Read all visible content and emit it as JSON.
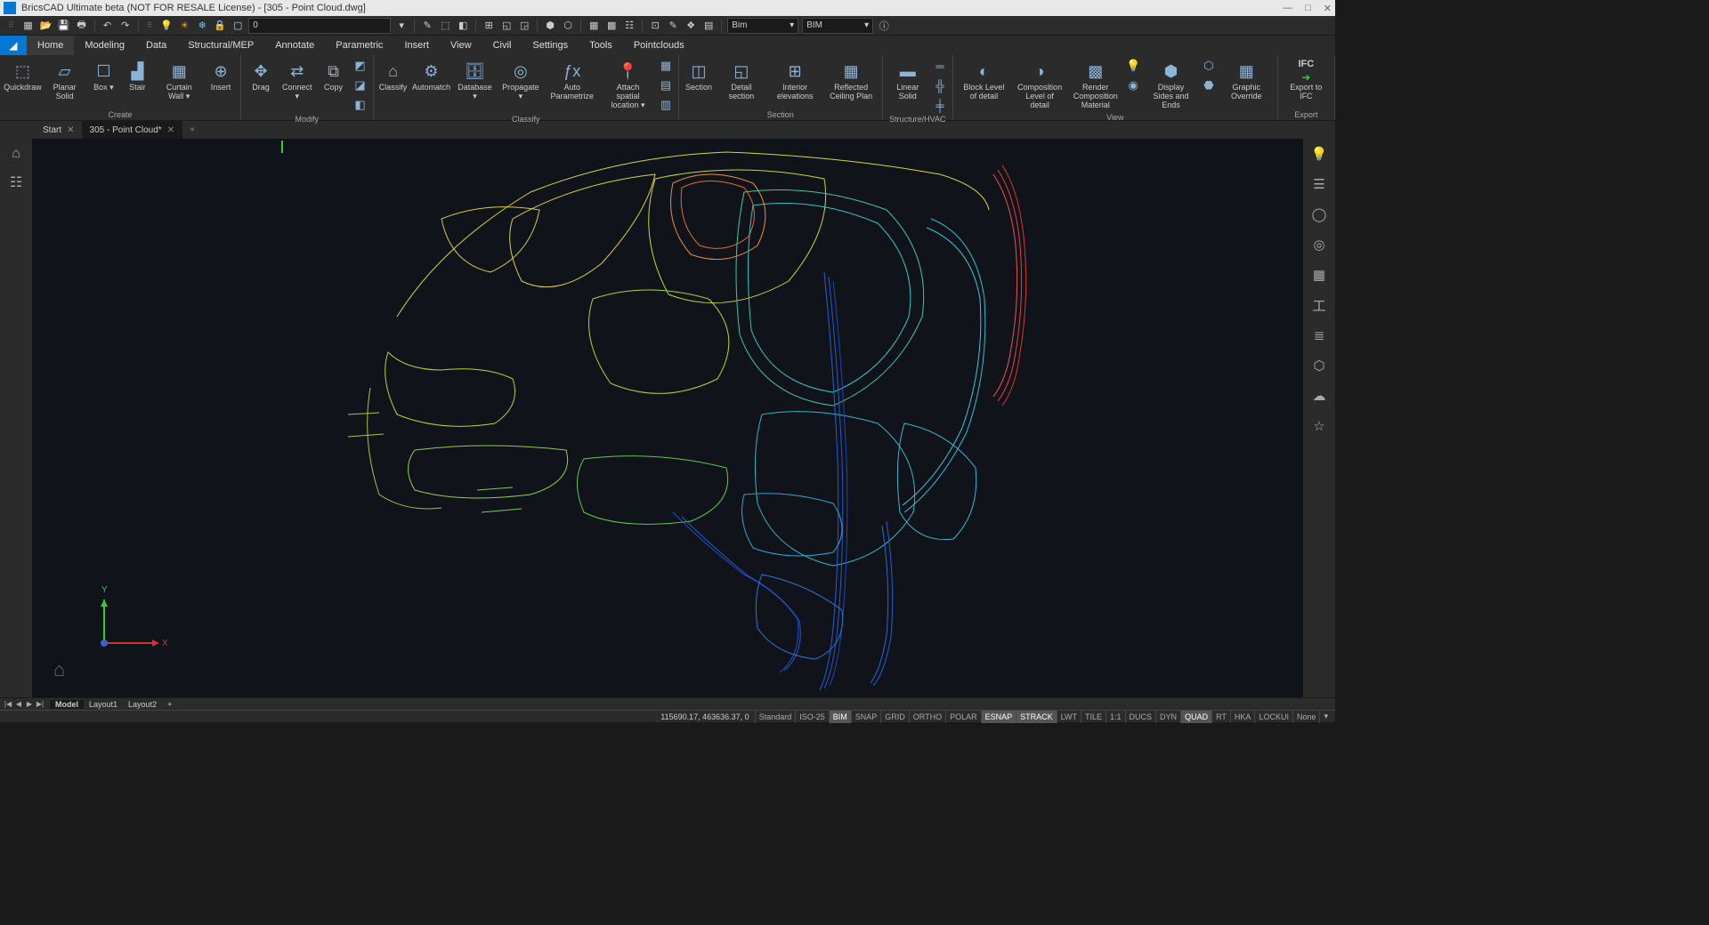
{
  "title": "BricsCAD Ultimate beta (NOT FOR RESALE License) - [305 - Point Cloud.dwg]",
  "qat": {
    "layer_value": "0",
    "combo1": "Bim",
    "combo2": "BIM"
  },
  "menu": [
    "Home",
    "Modeling",
    "Data",
    "Structural/MEP",
    "Annotate",
    "Parametric",
    "Insert",
    "View",
    "Civil",
    "Settings",
    "Tools",
    "Pointclouds"
  ],
  "ribbon": {
    "create": {
      "label": "Create",
      "items": [
        "Quickdraw",
        "Planar Solid",
        "Box ▾",
        "Stair",
        "Curtain Wall ▾",
        "Insert"
      ]
    },
    "modify": {
      "label": "Modify",
      "items": [
        "Drag",
        "Connect ▾",
        "Copy"
      ]
    },
    "classify": {
      "label": "Classify",
      "items": [
        "Classify",
        "Automatch",
        "Database ▾",
        "Propagate ▾",
        "Auto Parametrize",
        "Attach spatial location ▾"
      ]
    },
    "section": {
      "label": "Section",
      "items": [
        "Section",
        "Detail section",
        "Interior elevations",
        "Reflected Ceiling Plan"
      ]
    },
    "structure": {
      "label": "Structure/HVAC",
      "items": [
        "Linear Solid"
      ]
    },
    "view": {
      "label": "View",
      "items": [
        "Block Level of detail",
        "Composition Level of detail",
        "Render Composition Material",
        "Display Sides and Ends",
        "Graphic Override"
      ]
    },
    "export": {
      "label": "Export",
      "ifc": "IFC",
      "item": "Export to IFC"
    }
  },
  "doc_tabs": [
    {
      "label": "Start",
      "active": false
    },
    {
      "label": "305 - Point Cloud*",
      "active": true
    }
  ],
  "ucs": {
    "x": "X",
    "y": "Y"
  },
  "layout_tabs": {
    "model": "Model",
    "layouts": [
      "Layout1",
      "Layout2"
    ]
  },
  "status": {
    "coords": "115690.17, 463636.37, 0",
    "items": [
      {
        "l": "Standard",
        "on": false
      },
      {
        "l": "ISO-25",
        "on": false
      },
      {
        "l": "BIM",
        "on": true
      },
      {
        "l": "SNAP",
        "on": false
      },
      {
        "l": "GRID",
        "on": false
      },
      {
        "l": "ORTHO",
        "on": false
      },
      {
        "l": "POLAR",
        "on": false
      },
      {
        "l": "ESNAP",
        "on": true
      },
      {
        "l": "STRACK",
        "on": true
      },
      {
        "l": "LWT",
        "on": false
      },
      {
        "l": "TILE",
        "on": false
      },
      {
        "l": "1:1",
        "on": false
      },
      {
        "l": "DUCS",
        "on": false
      },
      {
        "l": "DYN",
        "on": false
      },
      {
        "l": "QUAD",
        "on": true
      },
      {
        "l": "RT",
        "on": false
      },
      {
        "l": "HKA",
        "on": false
      },
      {
        "l": "LOCKUI",
        "on": false
      },
      {
        "l": "None",
        "on": false
      }
    ]
  }
}
